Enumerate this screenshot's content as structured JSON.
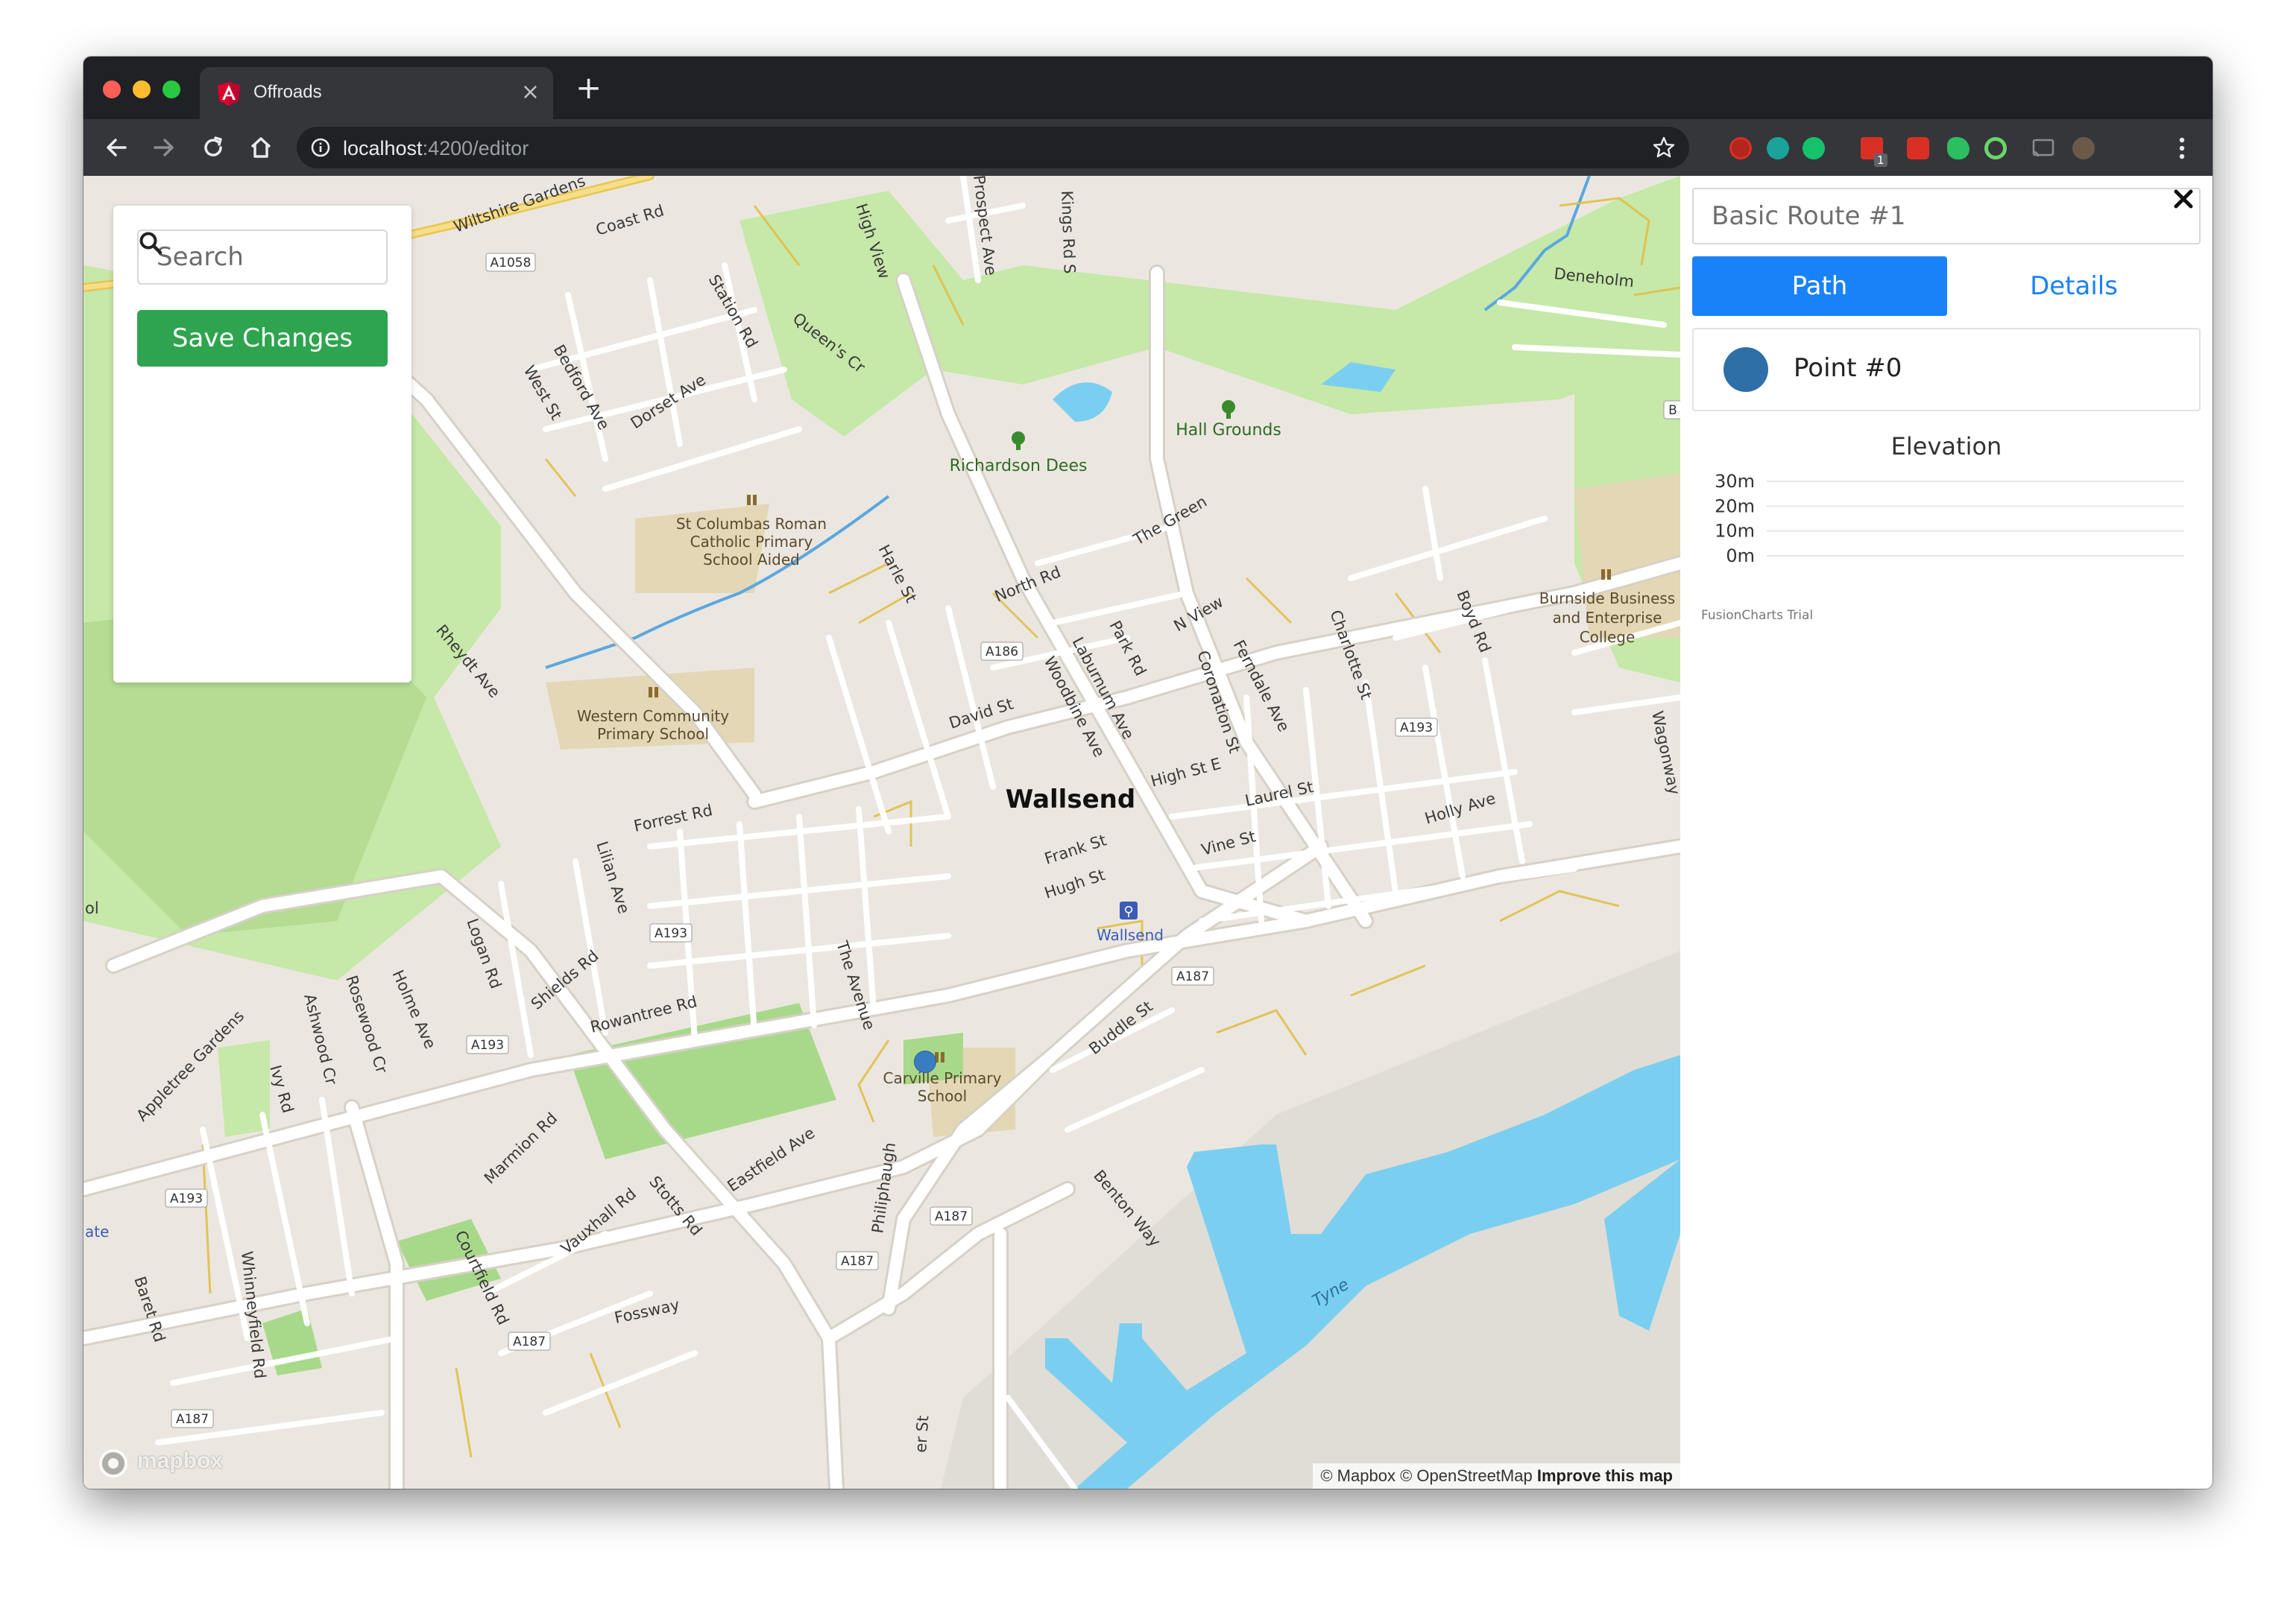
{
  "browser": {
    "tab_title": "Offroads",
    "url_host": "localhost",
    "url_rest": ":4200/editor",
    "extension_badge": "1"
  },
  "sidebar": {
    "search_placeholder": "Search",
    "save_label": "Save Changes"
  },
  "map": {
    "town": "Wallsend",
    "streets": [
      "Coast Rd",
      "Wiltshire Gardens",
      "Station Rd",
      "West St",
      "Bedford Ave",
      "Dorset Ave",
      "Queen's Cr",
      "High View",
      "Prospect Ave",
      "Kings Rd S",
      "Harle St",
      "North Rd",
      "Rheydt Ave",
      "The Green",
      "Park Rd",
      "Laburnum Ave",
      "Woodbine Ave",
      "N View",
      "Coronation St",
      "Ferndale Ave",
      "Charlotte St",
      "Boyd Rd",
      "David St",
      "High St E",
      "Laurel St",
      "Holly Ave",
      "Vine St",
      "Frank St",
      "Hugh St",
      "Forrest Rd",
      "Lilian Ave",
      "Logan Rd",
      "Shields Rd",
      "Rowantree Rd",
      "The Avenue",
      "Buddle St",
      "Appletree Gardens",
      "Ashwood Cr",
      "Rosewood Cr",
      "Holme Ave",
      "Ivy Rd",
      "Marmion Rd",
      "Eastfield Ave",
      "Philiphaugh",
      "Benton Way",
      "Courtfield Rd",
      "Vauxhall Rd",
      "Stotts Rd",
      "Fossway",
      "Baret Rd",
      "Whinneyfield Rd",
      "Deneholm",
      "Wagonway",
      "er St"
    ],
    "shields": [
      "A1058",
      "A186",
      "A193",
      "A193",
      "A187",
      "A193",
      "A193",
      "A187",
      "A187",
      "A187",
      "A187",
      "B"
    ],
    "places": {
      "st_columbas": [
        "St Columbas Roman",
        "Catholic Primary",
        "School Aided"
      ],
      "western": [
        "Western Community",
        "Primary School"
      ],
      "carville": [
        "Carville Primary",
        "School"
      ],
      "burnside": [
        "Burnside Business",
        "and Enterprise",
        "College"
      ],
      "richardson": "Richardson Dees",
      "hall_grounds": "Hall Grounds",
      "station": "Wallsend"
    },
    "water_label": "Tyne",
    "left_edge_fragments": [
      "ol",
      "ate"
    ],
    "attribution": {
      "mapbox": "© Mapbox",
      "osm": "© OpenStreetMap",
      "improve": "Improve this map"
    },
    "logo_text": "mapbox",
    "colors": {
      "land": "#ebe7e0",
      "park": "#c6e8a8",
      "water": "#7acff0",
      "route_point": "#3a7cc0"
    }
  },
  "panel": {
    "route_name": "Basic Route #1",
    "tabs": {
      "path": "Path",
      "details": "Details"
    },
    "active_tab": "path",
    "point_label": "Point #0",
    "elevation_title": "Elevation",
    "fusioncharts_note": "FusionCharts Trial",
    "colors": {
      "accent": "#1a82f7",
      "point": "#2f6fa8"
    }
  },
  "chart_data": {
    "type": "line",
    "title": "Elevation",
    "y_ticks": [
      "30m",
      "20m",
      "10m",
      "0m"
    ],
    "ylim": [
      0,
      30
    ],
    "series": [],
    "grid": true
  }
}
